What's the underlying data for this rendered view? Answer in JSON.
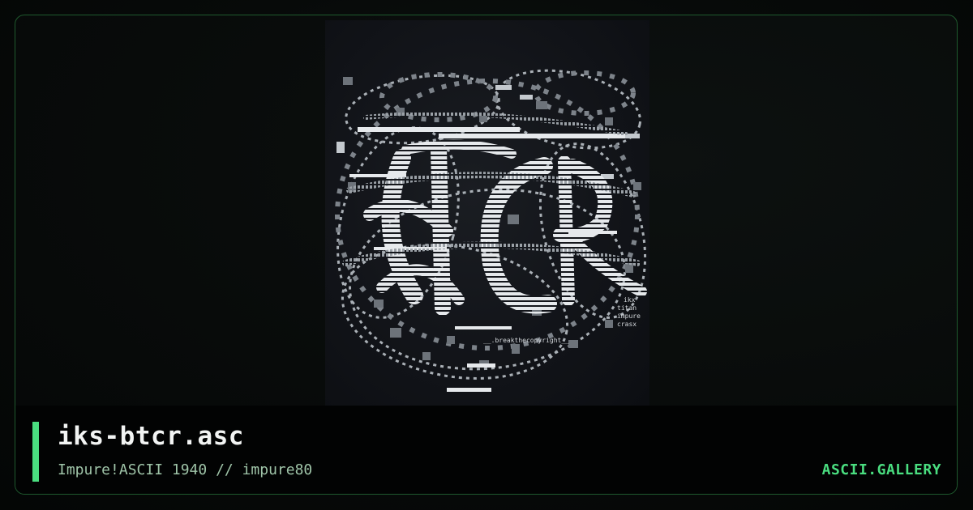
{
  "artwork": {
    "icon": "ascii-art-image",
    "signature": "__.breakthecopyright__",
    "credits": [
      "ikx",
      "titan",
      "impure",
      "crasx"
    ]
  },
  "footer": {
    "title": "iks-btcr.asc",
    "subtitle": "Impure!ASCII 1940 // impure80",
    "brand": "ASCII.GALLERY"
  },
  "colors": {
    "accent": "#4ade80",
    "frame_border": "#1f5a2e",
    "background": "#050807"
  }
}
